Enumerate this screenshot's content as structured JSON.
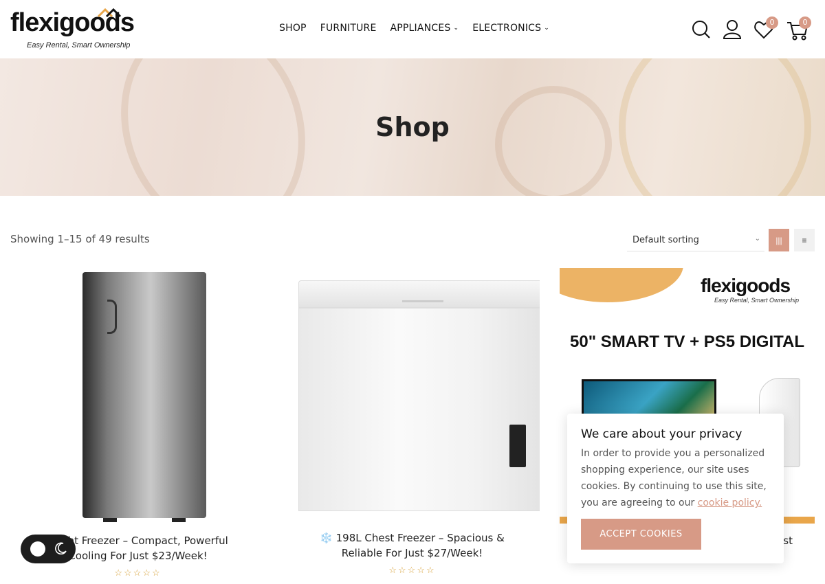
{
  "header": {
    "logo_text": "flexigoods",
    "logo_tagline": "Easy Rental, Smart Ownership",
    "nav": [
      {
        "label": "SHOP",
        "has_dropdown": false
      },
      {
        "label": "FURNITURE",
        "has_dropdown": false
      },
      {
        "label": "APPLIANCES",
        "has_dropdown": true
      },
      {
        "label": "ELECTRONICS",
        "has_dropdown": true
      }
    ],
    "icons": [
      "search-icon",
      "user-icon",
      "heart-icon",
      "cart-icon"
    ],
    "wishlist_count": "0",
    "cart_count": "0"
  },
  "banner": {
    "title": "Shop"
  },
  "toolbar": {
    "results_text": "Showing 1–15 of 49 results",
    "sort_selected": "Default sorting",
    "view_modes": [
      "grid",
      "list"
    ],
    "active_view": "grid"
  },
  "products": [
    {
      "title": "❄️ Upright Freezer – Compact, Powerful Cooling For Just $23/Week!",
      "visible_title": "pright Freezer – Compact, Powerful Cooling For Just $23/Week!",
      "rating": 0
    },
    {
      "title": "❄️ 198L Chest Freezer – Spacious & Reliable For Just $27/Week!",
      "rating": 0
    },
    {
      "title_fragment": "ust",
      "rating": 0,
      "ad": {
        "brand": "flexigoods",
        "tagline": "Easy Rental, Smart Ownership",
        "headline": "50\" SMART TV + PS5 DIGITAL"
      }
    }
  ],
  "cookie": {
    "title": "We care about your privacy",
    "body": "In order to provide you a personalized shopping experience, our site uses cookies. By continuing to use this site, you are agreeing to our",
    "link": "cookie policy.",
    "button": "ACCEPT COOKIES"
  },
  "colors": {
    "accent": "#d79a86",
    "star": "#d7a23a",
    "text": "#222222"
  }
}
